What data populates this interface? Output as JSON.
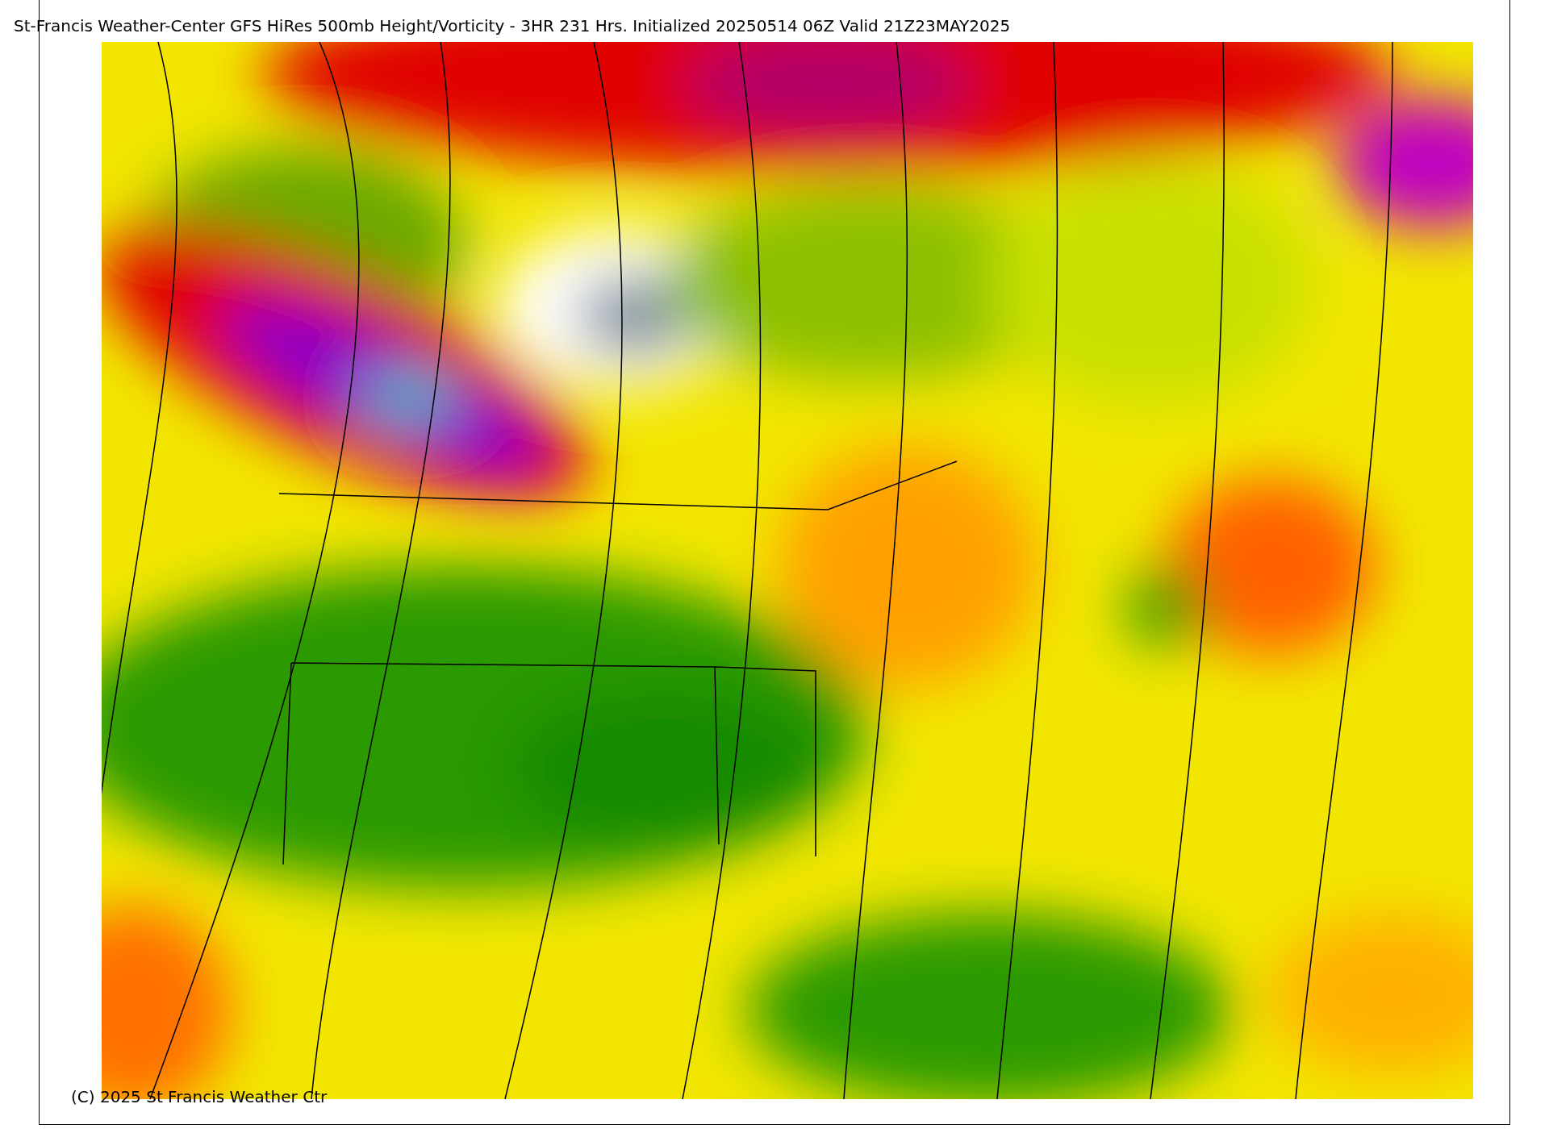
{
  "title": "St-Francis Weather-Center GFS HiRes 500mb Height/Vorticity - 3HR  231 Hrs.  Initialized 20250514 06Z Valid 21Z23MAY2025",
  "map": {
    "copyright": "(C) 2025 St Francis Weather Ctr"
  }
}
